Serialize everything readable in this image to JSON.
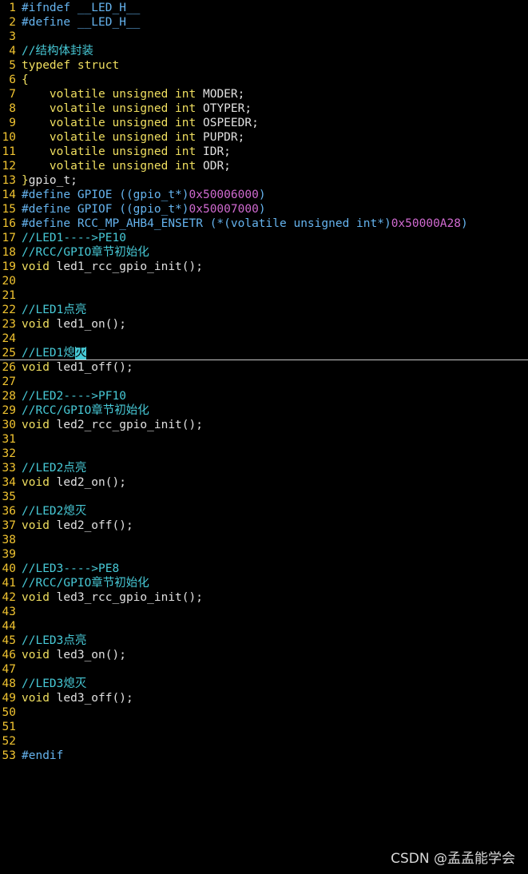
{
  "editor": {
    "lines": [
      {
        "n": "1",
        "tokens": [
          {
            "t": "pre",
            "v": "#ifndef __LED_H__"
          }
        ]
      },
      {
        "n": "2",
        "tokens": [
          {
            "t": "pre",
            "v": "#define __LED_H__"
          }
        ]
      },
      {
        "n": "3",
        "tokens": []
      },
      {
        "n": "4",
        "tokens": [
          {
            "t": "cmt",
            "v": "//结构体封装"
          }
        ]
      },
      {
        "n": "5",
        "tokens": [
          {
            "t": "kw",
            "v": "typedef struct"
          }
        ]
      },
      {
        "n": "6",
        "tokens": [
          {
            "t": "kw",
            "v": "{"
          }
        ]
      },
      {
        "n": "7",
        "tokens": [
          {
            "t": "txt",
            "v": "    "
          },
          {
            "t": "kw",
            "v": "volatile unsigned int"
          },
          {
            "t": "txt",
            "v": " MODER;"
          }
        ]
      },
      {
        "n": "8",
        "tokens": [
          {
            "t": "txt",
            "v": "    "
          },
          {
            "t": "kw",
            "v": "volatile unsigned int"
          },
          {
            "t": "txt",
            "v": " OTYPER;"
          }
        ]
      },
      {
        "n": "9",
        "tokens": [
          {
            "t": "txt",
            "v": "    "
          },
          {
            "t": "kw",
            "v": "volatile unsigned int"
          },
          {
            "t": "txt",
            "v": " OSPEEDR;"
          }
        ]
      },
      {
        "n": "10",
        "tokens": [
          {
            "t": "txt",
            "v": "    "
          },
          {
            "t": "kw",
            "v": "volatile unsigned int"
          },
          {
            "t": "txt",
            "v": " PUPDR;"
          }
        ]
      },
      {
        "n": "11",
        "tokens": [
          {
            "t": "txt",
            "v": "    "
          },
          {
            "t": "kw",
            "v": "volatile unsigned int"
          },
          {
            "t": "txt",
            "v": " IDR;"
          }
        ]
      },
      {
        "n": "12",
        "tokens": [
          {
            "t": "txt",
            "v": "    "
          },
          {
            "t": "kw",
            "v": "volatile unsigned int"
          },
          {
            "t": "txt",
            "v": " ODR;"
          }
        ]
      },
      {
        "n": "13",
        "tokens": [
          {
            "t": "kw",
            "v": "}"
          },
          {
            "t": "txt",
            "v": "gpio_t;"
          }
        ]
      },
      {
        "n": "14",
        "tokens": [
          {
            "t": "pre",
            "v": "#define GPIOE ((gpio_t*)"
          },
          {
            "t": "num",
            "v": "0x50006000"
          },
          {
            "t": "pre",
            "v": ")"
          }
        ]
      },
      {
        "n": "15",
        "tokens": [
          {
            "t": "pre",
            "v": "#define GPIOF ((gpio_t*)"
          },
          {
            "t": "num",
            "v": "0x50007000"
          },
          {
            "t": "pre",
            "v": ")"
          }
        ]
      },
      {
        "n": "16",
        "tokens": [
          {
            "t": "pre",
            "v": "#define RCC_MP_AHB4_ENSETR (*(volatile unsigned int*)"
          },
          {
            "t": "num",
            "v": "0x50000A28"
          },
          {
            "t": "pre",
            "v": ")"
          }
        ]
      },
      {
        "n": "17",
        "tokens": [
          {
            "t": "cmt",
            "v": "//LED1---->PE10"
          }
        ]
      },
      {
        "n": "18",
        "tokens": [
          {
            "t": "cmt",
            "v": "//RCC/GPIO章节初始化"
          }
        ]
      },
      {
        "n": "19",
        "tokens": [
          {
            "t": "kw",
            "v": "void"
          },
          {
            "t": "txt",
            "v": " led1_rcc_gpio_init();"
          }
        ]
      },
      {
        "n": "20",
        "tokens": []
      },
      {
        "n": "21",
        "tokens": []
      },
      {
        "n": "22",
        "tokens": [
          {
            "t": "cmt",
            "v": "//LED1点亮"
          }
        ]
      },
      {
        "n": "23",
        "tokens": [
          {
            "t": "kw",
            "v": "void"
          },
          {
            "t": "txt",
            "v": " led1_on();"
          }
        ]
      },
      {
        "n": "24",
        "tokens": []
      },
      {
        "n": "25",
        "cursorline": true,
        "tokens": [
          {
            "t": "cmt",
            "v": "//LED1熄"
          },
          {
            "t": "cursor",
            "v": "灭"
          }
        ]
      },
      {
        "n": "26",
        "tokens": [
          {
            "t": "kw",
            "v": "void"
          },
          {
            "t": "txt",
            "v": " led1_off();"
          }
        ]
      },
      {
        "n": "27",
        "tokens": []
      },
      {
        "n": "28",
        "tokens": [
          {
            "t": "cmt",
            "v": "//LED2---->PF10"
          }
        ]
      },
      {
        "n": "29",
        "tokens": [
          {
            "t": "cmt",
            "v": "//RCC/GPIO章节初始化"
          }
        ]
      },
      {
        "n": "30",
        "tokens": [
          {
            "t": "kw",
            "v": "void"
          },
          {
            "t": "txt",
            "v": " led2_rcc_gpio_init();"
          }
        ]
      },
      {
        "n": "31",
        "tokens": []
      },
      {
        "n": "32",
        "tokens": []
      },
      {
        "n": "33",
        "tokens": [
          {
            "t": "cmt",
            "v": "//LED2点亮"
          }
        ]
      },
      {
        "n": "34",
        "tokens": [
          {
            "t": "kw",
            "v": "void"
          },
          {
            "t": "txt",
            "v": " led2_on();"
          }
        ]
      },
      {
        "n": "35",
        "tokens": []
      },
      {
        "n": "36",
        "tokens": [
          {
            "t": "cmt",
            "v": "//LED2熄灭"
          }
        ]
      },
      {
        "n": "37",
        "tokens": [
          {
            "t": "kw",
            "v": "void"
          },
          {
            "t": "txt",
            "v": " led2_off();"
          }
        ]
      },
      {
        "n": "38",
        "tokens": []
      },
      {
        "n": "39",
        "tokens": []
      },
      {
        "n": "40",
        "tokens": [
          {
            "t": "cmt",
            "v": "//LED3---->PE8"
          }
        ]
      },
      {
        "n": "41",
        "tokens": [
          {
            "t": "cmt",
            "v": "//RCC/GPIO章节初始化"
          }
        ]
      },
      {
        "n": "42",
        "tokens": [
          {
            "t": "kw",
            "v": "void"
          },
          {
            "t": "txt",
            "v": " led3_rcc_gpio_init();"
          }
        ]
      },
      {
        "n": "43",
        "tokens": []
      },
      {
        "n": "44",
        "tokens": []
      },
      {
        "n": "45",
        "tokens": [
          {
            "t": "cmt",
            "v": "//LED3点亮"
          }
        ]
      },
      {
        "n": "46",
        "tokens": [
          {
            "t": "kw",
            "v": "void"
          },
          {
            "t": "txt",
            "v": " led3_on();"
          }
        ]
      },
      {
        "n": "47",
        "tokens": []
      },
      {
        "n": "48",
        "tokens": [
          {
            "t": "cmt",
            "v": "//LED3熄灭"
          }
        ]
      },
      {
        "n": "49",
        "tokens": [
          {
            "t": "kw",
            "v": "void"
          },
          {
            "t": "txt",
            "v": " led3_off();"
          }
        ]
      },
      {
        "n": "50",
        "tokens": []
      },
      {
        "n": "51",
        "tokens": []
      },
      {
        "n": "52",
        "tokens": []
      },
      {
        "n": "53",
        "tokens": [
          {
            "t": "pre",
            "v": "#endif"
          }
        ]
      }
    ]
  },
  "watermark": "CSDN @孟孟能学会",
  "colors": {
    "background": "#000000",
    "line_number": "#f0c330",
    "preprocessor": "#65b3ee",
    "comment": "#47c9d6",
    "keyword": "#f0df60",
    "number": "#d06ad0",
    "text": "#e0e0e0"
  }
}
